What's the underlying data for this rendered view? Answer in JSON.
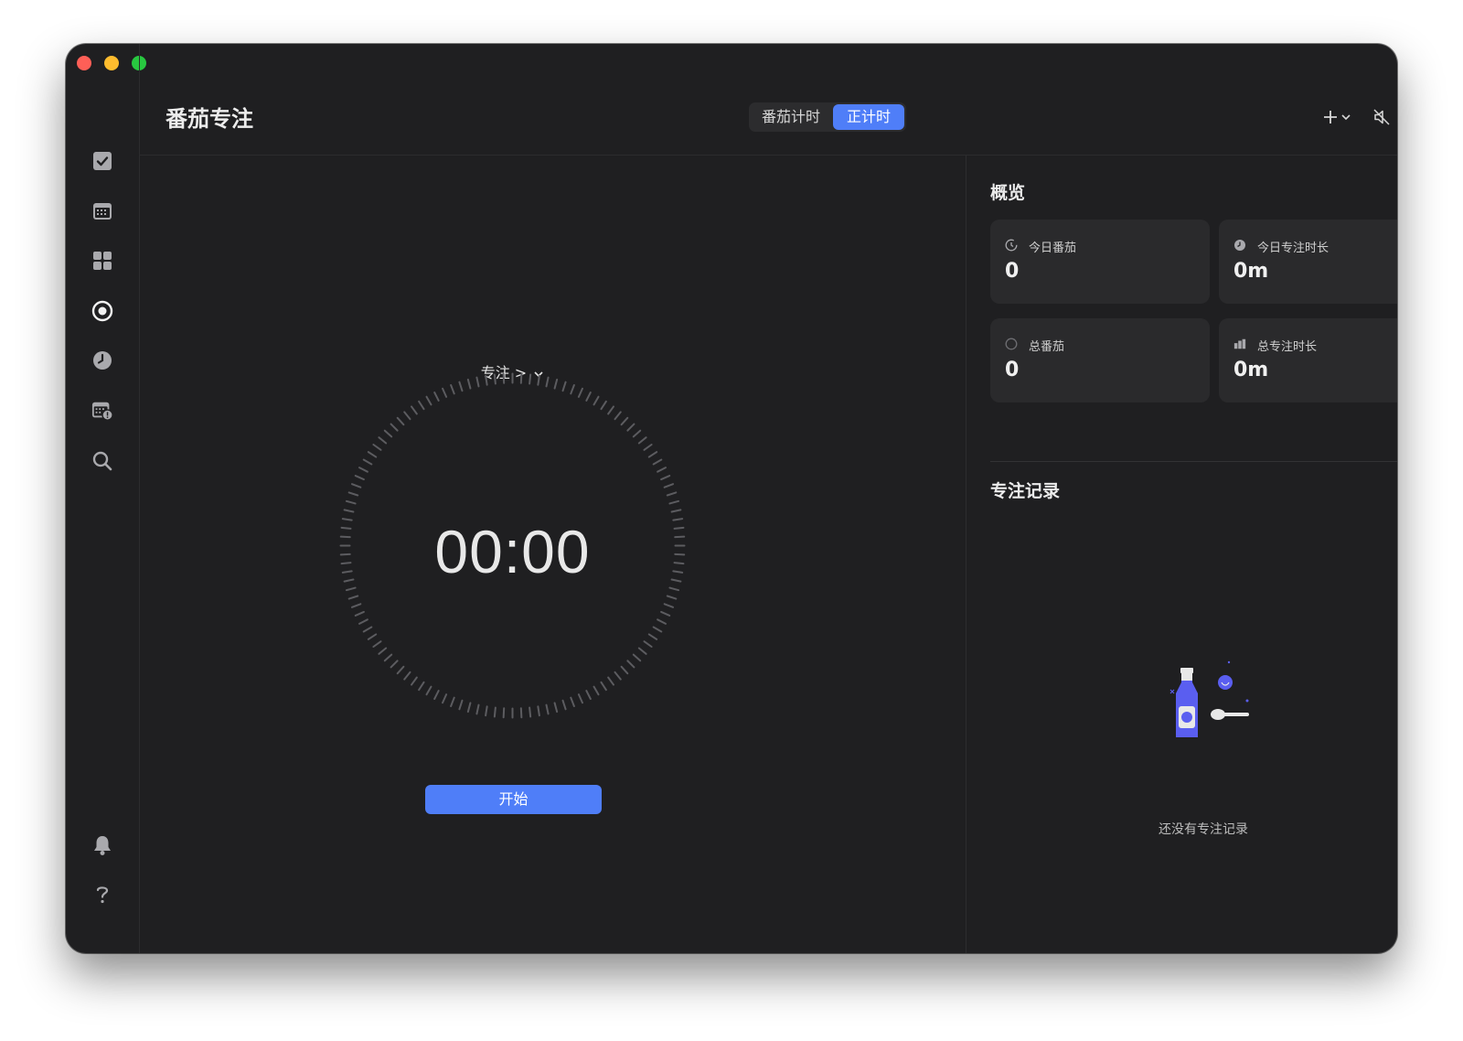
{
  "app": {
    "title": "番茄专注"
  },
  "mode_tabs": [
    {
      "label": "番茄计时",
      "active": false
    },
    {
      "label": "正计时",
      "active": true
    }
  ],
  "sidebar": {
    "items": [
      {
        "icon": "checkbox-icon",
        "active": false
      },
      {
        "icon": "calendar-icon",
        "active": false
      },
      {
        "icon": "grid-icon",
        "active": false
      },
      {
        "icon": "focus-target-icon",
        "active": true
      },
      {
        "icon": "clock-icon",
        "active": false
      },
      {
        "icon": "calendar-alert-icon",
        "active": false
      },
      {
        "icon": "search-icon",
        "active": false
      }
    ],
    "bottom": [
      {
        "icon": "bell-icon"
      },
      {
        "icon": "help-icon"
      }
    ]
  },
  "focus": {
    "label": "专注 >",
    "timer": "00:00",
    "start_label": "开始"
  },
  "overview": {
    "title": "概览",
    "cards": [
      {
        "label": "今日番茄",
        "value": "0",
        "icon": "timer-icon"
      },
      {
        "label": "今日专注时长",
        "value": "0m",
        "icon": "pie-clock-icon"
      },
      {
        "label": "总番茄",
        "value": "0",
        "icon": "circle-icon"
      },
      {
        "label": "总专注时长",
        "value": "0m",
        "icon": "bar-chart-icon"
      }
    ]
  },
  "records": {
    "title": "专注记录",
    "empty_text": "还没有专注记录"
  },
  "colors": {
    "accent": "#4f7ef8",
    "window_bg": "#1f1f21",
    "card_bg": "#2a2a2c",
    "text": "#ececec"
  }
}
